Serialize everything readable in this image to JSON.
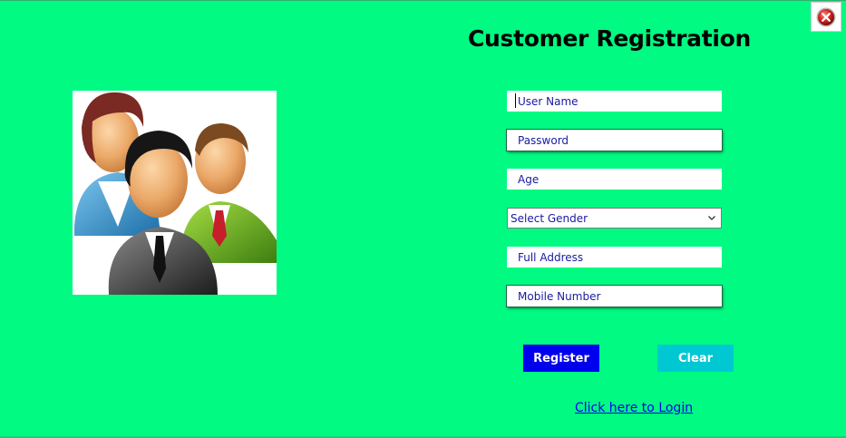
{
  "window": {
    "close_icon": "close-icon",
    "accent": "#00fa82"
  },
  "page": {
    "title": "Customer Registration",
    "illustration": "users-group-icon"
  },
  "form": {
    "username": {
      "placeholder": "User Name"
    },
    "password": {
      "placeholder": "Password"
    },
    "age": {
      "placeholder": "Age"
    },
    "gender": {
      "selected": "Select Gender"
    },
    "address": {
      "placeholder": "Full Address"
    },
    "mobile": {
      "placeholder": "Mobile Number"
    }
  },
  "buttons": {
    "register": {
      "label": "Register",
      "color": "#0000ee"
    },
    "clear": {
      "label": "Clear",
      "color": "#00c8d2"
    }
  },
  "links": {
    "login": "Click here to Login"
  }
}
